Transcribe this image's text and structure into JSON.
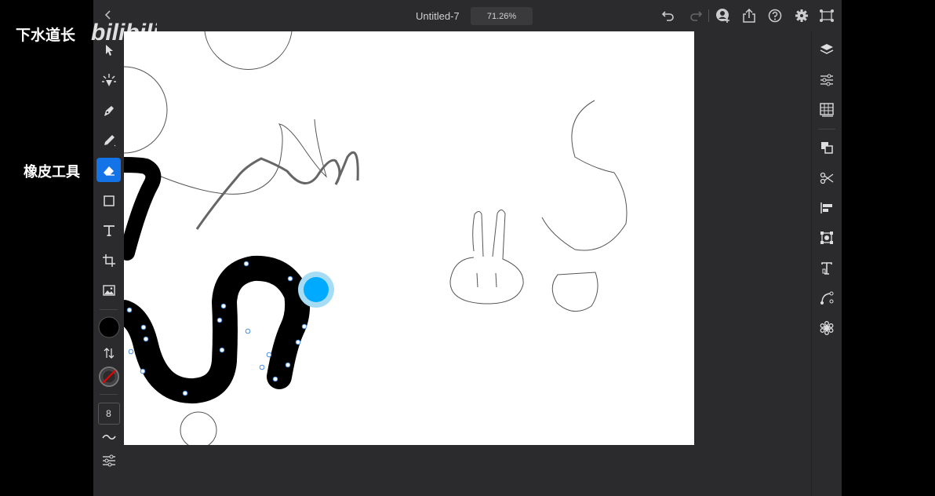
{
  "overlay": {
    "uploader_name": "下水道长",
    "caption": "橡皮工具",
    "logo": "bilibili"
  },
  "topbar": {
    "back_icon": "chevron-left-icon",
    "document_title": "Untitled-7",
    "zoom_level": "71.26%",
    "icons": [
      "undo-icon",
      "redo-icon",
      "invite-user-icon",
      "share-icon",
      "help-icon",
      "settings-icon",
      "fullscreen-icon"
    ]
  },
  "left_toolbar": {
    "tools": [
      "select-tool",
      "touch-shortcut-tool",
      "pen-tool",
      "pencil-tool",
      "eraser-tool",
      "shape-tool",
      "text-tool",
      "crop-tool",
      "image-tool"
    ],
    "active_tool": "eraser-tool",
    "fill_color": "#000000",
    "stroke_color": "none",
    "brush_size": "8"
  },
  "right_panel": {
    "icons": [
      "layers-icon",
      "properties-icon",
      "assets-icon",
      "arrange-icon",
      "path-icon",
      "align-icon",
      "transform-icon",
      "text-icon",
      "curvature-icon",
      "symbol-icon"
    ]
  },
  "colors": {
    "app_bg": "#2b2b2e",
    "accent": "#1473e6",
    "canvas": "#ffffff",
    "eraser_cursor": "#00aaff"
  }
}
